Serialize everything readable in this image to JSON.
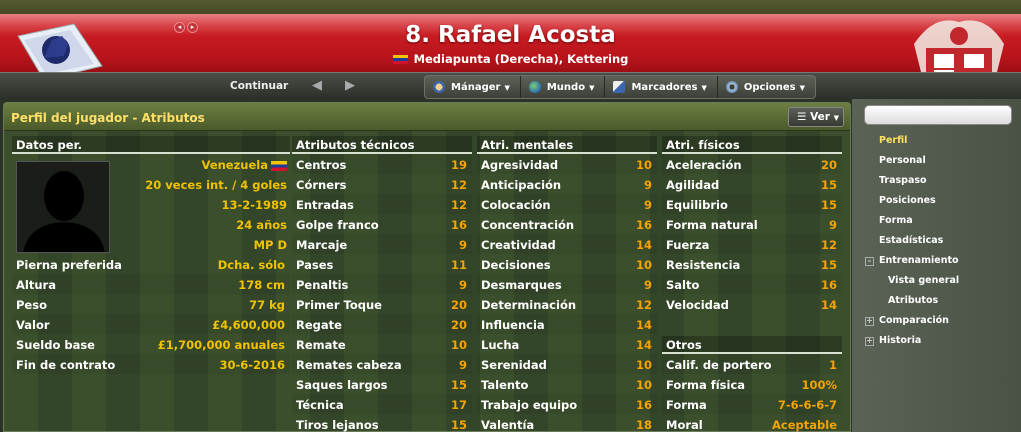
{
  "header": {
    "title": "8. Rafael Acosta",
    "subtitle": "Mediapunta (Derecha), Kettering",
    "nav_back": "◂",
    "nav_fwd": "▸"
  },
  "toolbar": {
    "continue_label": "Continuar",
    "menus": [
      {
        "label": "Mánager",
        "icon": "manager-icon"
      },
      {
        "label": "Mundo",
        "icon": "globe-icon"
      },
      {
        "label": "Marcadores",
        "icon": "bookmark-icon"
      },
      {
        "label": "Opciones",
        "icon": "gear-icon"
      }
    ]
  },
  "panel": {
    "title": "Perfil del jugador - Atributos",
    "ver_label": "Ver"
  },
  "personal": {
    "header": "Datos per.",
    "nationality": "Venezuela",
    "caps": "20 veces int. / 4 goles",
    "dob": "13-2-1989",
    "age": "24 años",
    "position": "MP D",
    "rows": [
      {
        "label": "Pierna preferida",
        "value": "Dcha. sólo"
      },
      {
        "label": "Altura",
        "value": "178 cm"
      },
      {
        "label": "Peso",
        "value": "77 kg"
      },
      {
        "label": "Valor",
        "value": "£4,600,000"
      },
      {
        "label": "Sueldo base",
        "value": "£1,700,000 anuales"
      },
      {
        "label": "Fin de contrato",
        "value": "30-6-2016"
      }
    ]
  },
  "technical": {
    "header": "Atributos técnicos",
    "rows": [
      {
        "label": "Centros",
        "value": "19"
      },
      {
        "label": "Córners",
        "value": "12"
      },
      {
        "label": "Entradas",
        "value": "12"
      },
      {
        "label": "Golpe franco",
        "value": "16"
      },
      {
        "label": "Marcaje",
        "value": "9"
      },
      {
        "label": "Pases",
        "value": "11"
      },
      {
        "label": "Penaltis",
        "value": "9"
      },
      {
        "label": "Primer Toque",
        "value": "20"
      },
      {
        "label": "Regate",
        "value": "20"
      },
      {
        "label": "Remate",
        "value": "10"
      },
      {
        "label": "Remates cabeza",
        "value": "9"
      },
      {
        "label": "Saques largos",
        "value": "15"
      },
      {
        "label": "Técnica",
        "value": "17"
      },
      {
        "label": "Tiros lejanos",
        "value": "15"
      }
    ]
  },
  "mental": {
    "header": "Atri. mentales",
    "rows": [
      {
        "label": "Agresividad",
        "value": "10"
      },
      {
        "label": "Anticipación",
        "value": "9"
      },
      {
        "label": "Colocación",
        "value": "9"
      },
      {
        "label": "Concentración",
        "value": "16"
      },
      {
        "label": "Creatividad",
        "value": "14"
      },
      {
        "label": "Decisiones",
        "value": "10"
      },
      {
        "label": "Desmarques",
        "value": "9"
      },
      {
        "label": "Determinación",
        "value": "12"
      },
      {
        "label": "Influencia",
        "value": "14"
      },
      {
        "label": "Lucha",
        "value": "14"
      },
      {
        "label": "Serenidad",
        "value": "10"
      },
      {
        "label": "Talento",
        "value": "10"
      },
      {
        "label": "Trabajo equipo",
        "value": "16"
      },
      {
        "label": "Valentía",
        "value": "18"
      }
    ]
  },
  "physical": {
    "header": "Atri. físicos",
    "rows": [
      {
        "label": "Aceleración",
        "value": "20"
      },
      {
        "label": "Agilidad",
        "value": "15"
      },
      {
        "label": "Equilibrio",
        "value": "15"
      },
      {
        "label": "Forma natural",
        "value": "9"
      },
      {
        "label": "Fuerza",
        "value": "12"
      },
      {
        "label": "Resistencia",
        "value": "15"
      },
      {
        "label": "Salto",
        "value": "16"
      },
      {
        "label": "Velocidad",
        "value": "14"
      }
    ]
  },
  "others": {
    "header": "Otros",
    "rows": [
      {
        "label": "Calif. de portero",
        "value": "1"
      },
      {
        "label": "Forma física",
        "value": "100%"
      },
      {
        "label": "Forma",
        "value": "7-6-6-6-7"
      },
      {
        "label": "Moral",
        "value": "Aceptable"
      }
    ]
  },
  "sidebar": {
    "items": [
      {
        "label": "Perfil",
        "selected": true
      },
      {
        "label": "Personal"
      },
      {
        "label": "Traspaso"
      },
      {
        "label": "Posiciones"
      },
      {
        "label": "Forma"
      },
      {
        "label": "Estadísticas"
      },
      {
        "label": "Entrenamiento",
        "expander": "-"
      },
      {
        "label": "Vista general",
        "sub": true
      },
      {
        "label": "Atributos",
        "sub": true
      },
      {
        "label": "Comparación",
        "expander": "+"
      },
      {
        "label": "Historia",
        "expander": "+"
      }
    ]
  }
}
